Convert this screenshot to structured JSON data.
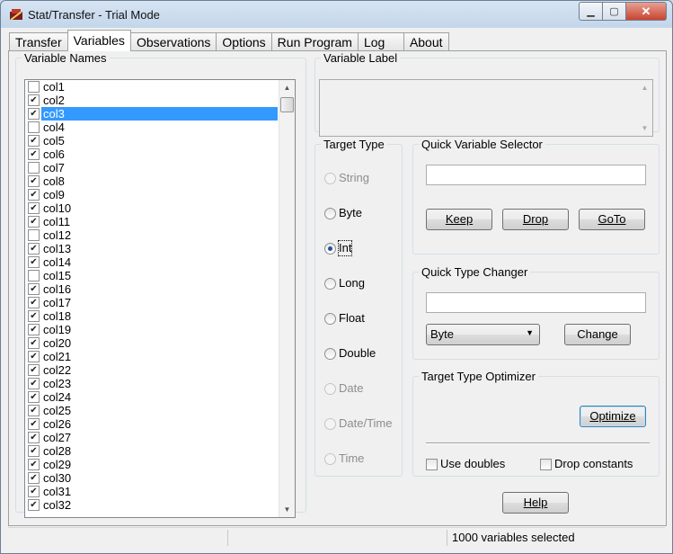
{
  "window": {
    "title": "Stat/Transfer - Trial Mode"
  },
  "tabs": [
    {
      "label": "Transfer",
      "active": false
    },
    {
      "label": "Variables",
      "active": true
    },
    {
      "label": "Observations",
      "active": false
    },
    {
      "label": "Options",
      "active": false
    },
    {
      "label": "Run Program",
      "active": false
    },
    {
      "label": "Log",
      "active": false
    },
    {
      "label": "About",
      "active": false
    }
  ],
  "variable_names": {
    "legend": "Variable Names",
    "items": [
      {
        "label": "col1",
        "checked": false
      },
      {
        "label": "col2",
        "checked": true
      },
      {
        "label": "col3",
        "checked": true,
        "selected": true
      },
      {
        "label": "col4",
        "checked": false
      },
      {
        "label": "col5",
        "checked": true
      },
      {
        "label": "col6",
        "checked": true
      },
      {
        "label": "col7",
        "checked": false
      },
      {
        "label": "col8",
        "checked": true
      },
      {
        "label": "col9",
        "checked": true
      },
      {
        "label": "col10",
        "checked": true
      },
      {
        "label": "col11",
        "checked": true
      },
      {
        "label": "col12",
        "checked": false
      },
      {
        "label": "col13",
        "checked": true
      },
      {
        "label": "col14",
        "checked": true
      },
      {
        "label": "col15",
        "checked": false
      },
      {
        "label": "col16",
        "checked": true
      },
      {
        "label": "col17",
        "checked": true
      },
      {
        "label": "col18",
        "checked": true
      },
      {
        "label": "col19",
        "checked": true
      },
      {
        "label": "col20",
        "checked": true
      },
      {
        "label": "col21",
        "checked": true
      },
      {
        "label": "col22",
        "checked": true
      },
      {
        "label": "col23",
        "checked": true
      },
      {
        "label": "col24",
        "checked": true
      },
      {
        "label": "col25",
        "checked": true
      },
      {
        "label": "col26",
        "checked": true
      },
      {
        "label": "col27",
        "checked": true
      },
      {
        "label": "col28",
        "checked": true
      },
      {
        "label": "col29",
        "checked": true
      },
      {
        "label": "col30",
        "checked": true
      },
      {
        "label": "col31",
        "checked": true
      },
      {
        "label": "col32",
        "checked": true
      }
    ]
  },
  "variable_label": {
    "legend": "Variable Label",
    "value": ""
  },
  "target_type": {
    "legend": "Target Type",
    "options": [
      {
        "label": "String",
        "enabled": false,
        "checked": false
      },
      {
        "label": "Byte",
        "enabled": true,
        "checked": false
      },
      {
        "label": "Int",
        "enabled": true,
        "checked": true
      },
      {
        "label": "Long",
        "enabled": true,
        "checked": false
      },
      {
        "label": "Float",
        "enabled": true,
        "checked": false
      },
      {
        "label": "Double",
        "enabled": true,
        "checked": false
      },
      {
        "label": "Date",
        "enabled": false,
        "checked": false
      },
      {
        "label": "Date/Time",
        "enabled": false,
        "checked": false
      },
      {
        "label": "Time",
        "enabled": false,
        "checked": false
      }
    ]
  },
  "quick_selector": {
    "legend": "Quick Variable Selector",
    "input_value": "",
    "keep_label": "Keep",
    "drop_label": "Drop",
    "goto_label": "GoTo"
  },
  "quick_type_changer": {
    "legend": "Quick Type Changer",
    "input_value": "",
    "selected_type": "Byte",
    "change_label": "Change"
  },
  "optimizer": {
    "legend": "Target Type Optimizer",
    "optimize_label": "Optimize",
    "use_doubles_label": "Use doubles",
    "use_doubles_checked": false,
    "drop_constants_label": "Drop constants",
    "drop_constants_checked": false
  },
  "help_label": "Help",
  "status": {
    "pane1": "",
    "pane2": "",
    "pane3": "1000 variables selected"
  }
}
